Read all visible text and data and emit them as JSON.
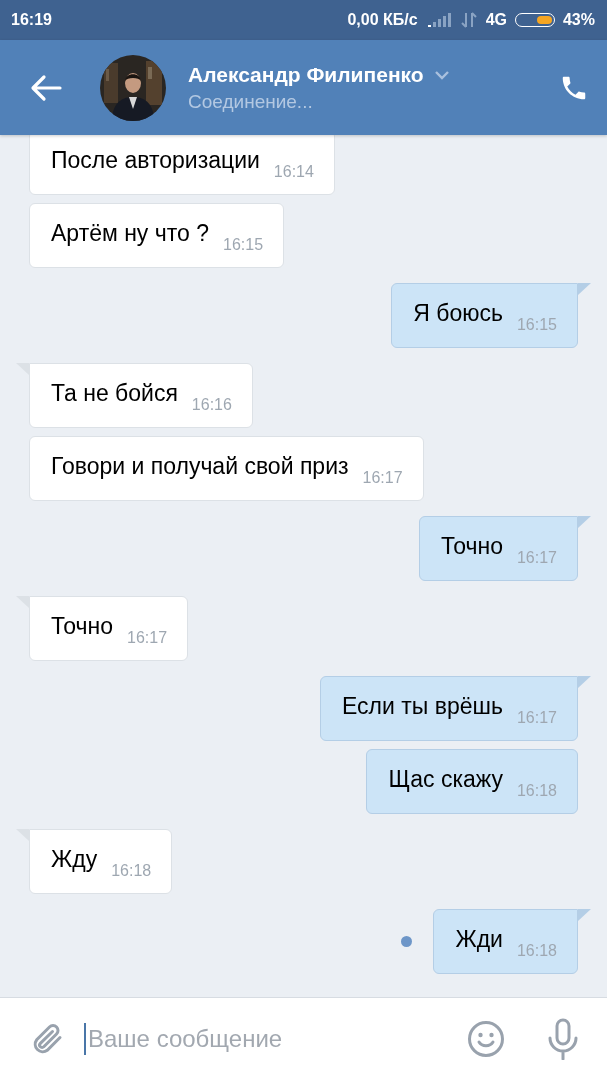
{
  "status_bar": {
    "time": "16:19",
    "speed": "0,00 КБ/с",
    "network": "4G",
    "battery": {
      "level": 0.43
    },
    "battery_text": "43%"
  },
  "header": {
    "name": "Александр Филипенко",
    "subtitle": "Соединение..."
  },
  "messages": [
    {
      "kind": "incoming",
      "text": "После авторизации",
      "time": "16:14",
      "unread": false
    },
    {
      "kind": "incoming",
      "text": "Артём ну что ?",
      "time": "16:15",
      "unread": false
    },
    {
      "kind": "outgoing",
      "text": "Я боюсь",
      "time": "16:15",
      "unread": false
    },
    {
      "kind": "incoming",
      "text": "Та не бойся",
      "time": "16:16",
      "unread": false
    },
    {
      "kind": "incoming",
      "text": "Говори и получай свой приз",
      "time": "16:17",
      "unread": false
    },
    {
      "kind": "outgoing",
      "text": "Точно",
      "time": "16:17",
      "unread": false
    },
    {
      "kind": "incoming",
      "text": "Точно",
      "time": "16:17",
      "unread": false
    },
    {
      "kind": "outgoing",
      "text": "Если ты врёшь",
      "time": "16:17",
      "unread": false
    },
    {
      "kind": "outgoing",
      "text": "Щас скажу",
      "time": "16:18",
      "unread": false
    },
    {
      "kind": "incoming",
      "text": "Жду",
      "time": "16:18",
      "unread": false
    },
    {
      "kind": "outgoing",
      "text": "Жди",
      "time": "16:18",
      "unread": true
    }
  ],
  "composer": {
    "placeholder": "Ваше сообщение"
  }
}
